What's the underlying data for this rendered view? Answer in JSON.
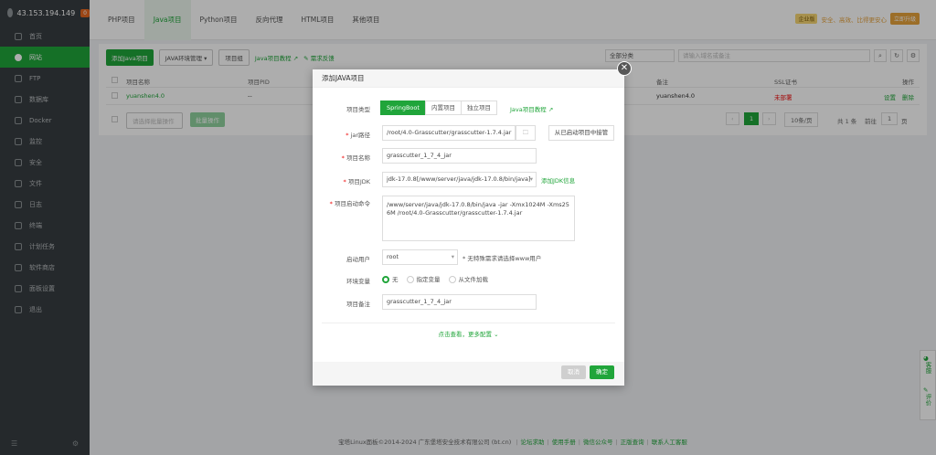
{
  "sidebar": {
    "ip": "43.153.194.149",
    "badge": "0",
    "items": [
      {
        "label": "首页",
        "icon": "home-icon"
      },
      {
        "label": "网站",
        "icon": "globe-icon"
      },
      {
        "label": "FTP",
        "icon": "ftp-icon"
      },
      {
        "label": "数据库",
        "icon": "database-icon"
      },
      {
        "label": "Docker",
        "icon": "docker-icon"
      },
      {
        "label": "监控",
        "icon": "monitor-icon"
      },
      {
        "label": "安全",
        "icon": "shield-icon"
      },
      {
        "label": "文件",
        "icon": "folder-icon"
      },
      {
        "label": "日志",
        "icon": "log-icon"
      },
      {
        "label": "终端",
        "icon": "terminal-icon"
      },
      {
        "label": "计划任务",
        "icon": "calendar-icon"
      },
      {
        "label": "软件商店",
        "icon": "store-icon"
      },
      {
        "label": "面板设置",
        "icon": "settings-icon"
      },
      {
        "label": "退出",
        "icon": "logout-icon"
      }
    ]
  },
  "tabs": [
    "PHP项目",
    "Java项目",
    "Python项目",
    "反向代理",
    "HTML项目",
    "其他项目"
  ],
  "topbar": {
    "brand": "企业版",
    "warn": "安全、高效、比得更安心",
    "upgrade": "立即升级"
  },
  "toolbar": {
    "add_btn": "添加Java项目",
    "env_mgmt": "JAVA环境管理",
    "project_group": "项目组",
    "tutorial": "Java项目教程",
    "feedback": "需求反馈",
    "category": "全部分类",
    "search_placeholder": "请输入域名或备注"
  },
  "table": {
    "headers": [
      "项目名称",
      "项目PID",
      "备注",
      "SSL证书",
      "操作"
    ],
    "row": {
      "name": "yuanshen4.0",
      "pid": "--",
      "remark": "yuanshen4.0",
      "ssl": "未部署",
      "action_set": "设置",
      "action_del": "删除"
    },
    "batch_placeholder": "请选择批量操作",
    "batch_btn": "批量操作",
    "page": "1",
    "per_page": "10条/页",
    "total": "共 1 条",
    "goto": "前往",
    "goto_page": "1",
    "page_unit": "页"
  },
  "modal": {
    "title": "添加JAVA项目",
    "project_type_label": "项目类型",
    "types": [
      "SpringBoot",
      "内置项目",
      "独立项目"
    ],
    "type_tutorial": "Java项目教程",
    "jar_label": "jar路径",
    "jar_value": "/root/4.0-Grasscutter/grasscutter-1.7.4.jar",
    "take_over": "从已启动项目中接管",
    "name_label": "项目名称",
    "name_value": "grasscutter_1_7_4_jar",
    "jdk_label": "项目JDK",
    "jdk_value": "jdk-17.0.8[/www/server/java/jdk-17.0.8/bin/java]",
    "add_jdk": "添加JDK信息",
    "cmd_label": "项目启动命令",
    "cmd_value": "/www/server/java/jdk-17.0.8/bin/java -jar  -Xmx1024M -Xms256M /root/4.0-Grasscutter/grasscutter-1.7.4.jar",
    "user_label": "启动用户",
    "user_value": "root",
    "user_hint": "* 无特殊需求请选择www用户",
    "env_label": "环境变量",
    "env_options": [
      "无",
      "指定变量",
      "从文件加载"
    ],
    "remark_label": "项目备注",
    "remark_value": "grasscutter_1_7_4_jar",
    "more": "点击查看，更多配置",
    "cancel": "取消",
    "confirm": "确定"
  },
  "footer": {
    "copyright": "宝塔Linux面板©2014-2024 广东堡塔安全技术有限公司 (bt.cn)",
    "links": [
      "论坛求助",
      "使用手册",
      "微信公众号",
      "正版查询",
      "联系人工客服"
    ]
  },
  "float": {
    "service": "客服",
    "rate": "评价"
  },
  "colors": {
    "accent": "#20a53a",
    "sidebar": "#373d41",
    "danger": "#ef0808"
  }
}
